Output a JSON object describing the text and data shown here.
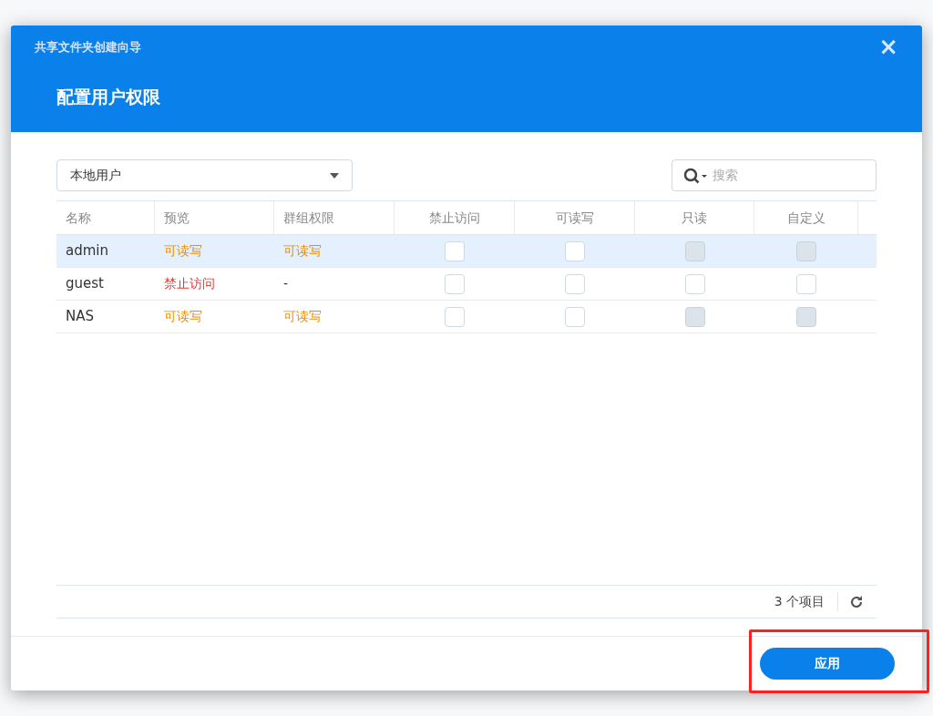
{
  "dialog": {
    "title": "共享文件夹创建向导",
    "heading": "配置用户权限",
    "close": "×"
  },
  "filter": {
    "value": "本地用户"
  },
  "search": {
    "placeholder": "搜索"
  },
  "table": {
    "columns": [
      "名称",
      "预览",
      "群组权限",
      "禁止访问",
      "可读写",
      "只读",
      "自定义"
    ],
    "rows": [
      {
        "name": "admin",
        "preview": {
          "text": "可读写",
          "kind": "readwrite"
        },
        "group": {
          "text": "可读写",
          "kind": "readwrite"
        },
        "selected": true,
        "boxes": [
          {
            "checked": false,
            "disabled": false
          },
          {
            "checked": false,
            "disabled": false
          },
          {
            "checked": false,
            "disabled": true
          },
          {
            "checked": false,
            "disabled": true
          }
        ]
      },
      {
        "name": "guest",
        "preview": {
          "text": "禁止访问",
          "kind": "denied"
        },
        "group": {
          "text": "-",
          "kind": "none"
        },
        "selected": false,
        "boxes": [
          {
            "checked": false,
            "disabled": false
          },
          {
            "checked": false,
            "disabled": false
          },
          {
            "checked": false,
            "disabled": false
          },
          {
            "checked": false,
            "disabled": false
          }
        ]
      },
      {
        "name": "NAS",
        "preview": {
          "text": "可读写",
          "kind": "readwrite"
        },
        "group": {
          "text": "可读写",
          "kind": "readwrite"
        },
        "selected": false,
        "boxes": [
          {
            "checked": false,
            "disabled": false
          },
          {
            "checked": false,
            "disabled": false
          },
          {
            "checked": false,
            "disabled": true
          },
          {
            "checked": false,
            "disabled": true
          }
        ]
      }
    ]
  },
  "footer": {
    "count": "3 个项目"
  },
  "apply_button": {
    "label": "应用",
    "highlighted": true
  }
}
